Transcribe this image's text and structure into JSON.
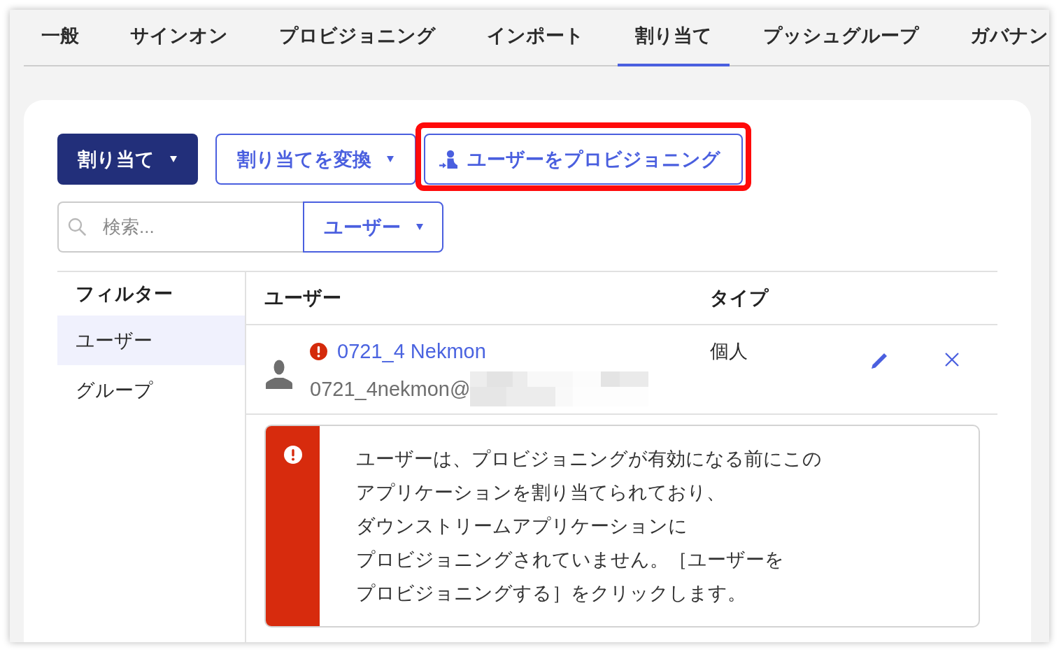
{
  "tabs": [
    {
      "label": "一般",
      "selected": false
    },
    {
      "label": "サインオン",
      "selected": false
    },
    {
      "label": "プロビジョニング",
      "selected": false
    },
    {
      "label": "インポート",
      "selected": false
    },
    {
      "label": "割り当て",
      "selected": true
    },
    {
      "label": "プッシュグループ",
      "selected": false
    },
    {
      "label": "ガバナン",
      "selected": false
    }
  ],
  "actions": [
    {
      "kind": "primary",
      "label": "割り当て",
      "highlighted": false
    },
    {
      "kind": "dropdown",
      "label": "割り当てを変換",
      "highlighted": false
    },
    {
      "kind": "provision",
      "label": "ユーザーをプロビジョニング",
      "highlighted": true
    }
  ],
  "search": {
    "placeholder": "検索...",
    "scope": "ユーザー"
  },
  "filter": {
    "title": "フィルター",
    "items": [
      {
        "label": "ユーザー",
        "selected": true
      },
      {
        "label": "グループ",
        "selected": false
      }
    ]
  },
  "table": {
    "columns": [
      "ユーザー",
      "タイプ"
    ],
    "rows": [
      {
        "name": "0721_4 Nekmon",
        "error": true,
        "email": "0721_4nekmon@",
        "email_redacted": true,
        "type": "個人"
      }
    ]
  },
  "alert": {
    "kind": "error",
    "lines": [
      "ユーザーは、プロビジョニングが有効になる前にこの",
      "アプリケーションを割り当てられており、",
      "ダウンストリームアプリケーションに",
      "プロビジョニングされていません。［ユーザーを",
      "プロビジョニングする］をクリックします。"
    ]
  }
}
